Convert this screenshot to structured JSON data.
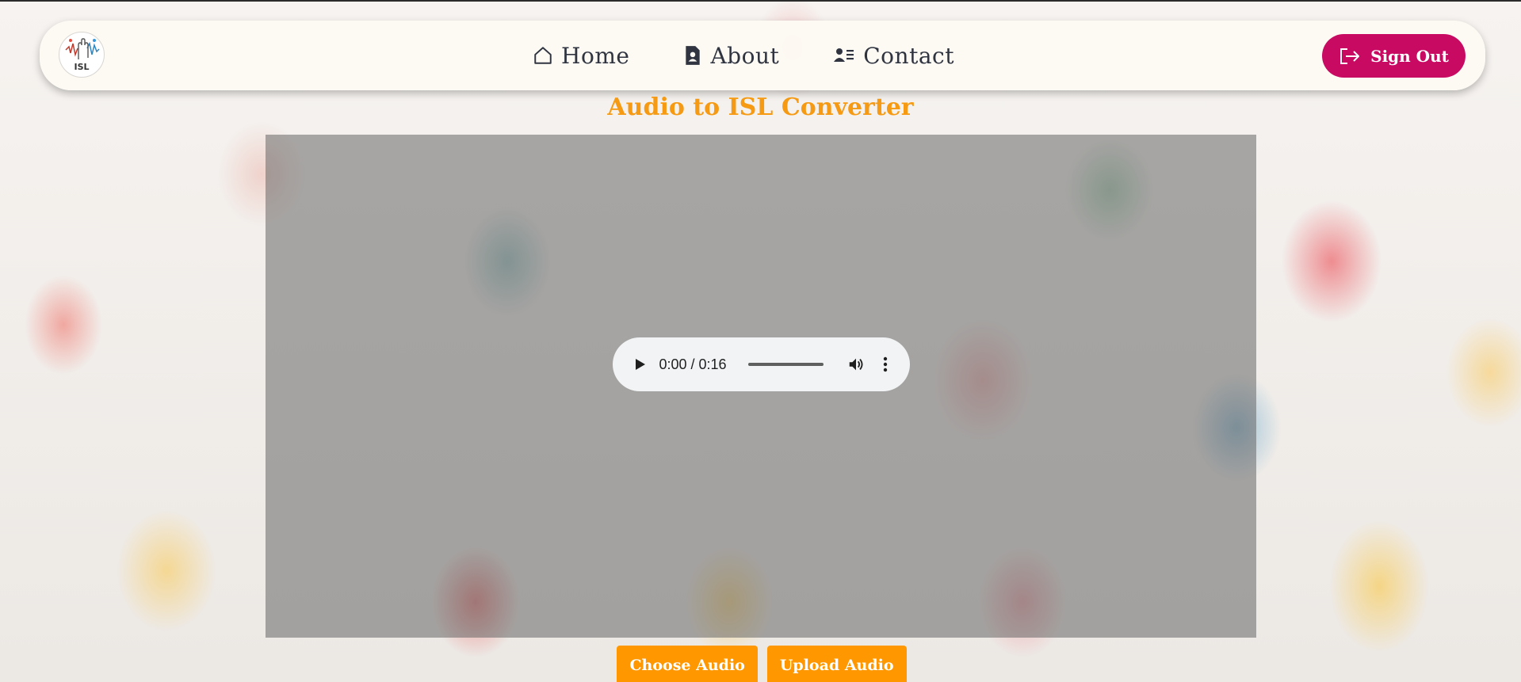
{
  "logo": {
    "text": "ISL"
  },
  "nav": {
    "items": [
      {
        "label": "Home",
        "icon": "home-icon"
      },
      {
        "label": "About",
        "icon": "document-user-icon"
      },
      {
        "label": "Contact",
        "icon": "contact-card-icon"
      }
    ],
    "sign_out_label": "Sign Out",
    "sign_out_icon": "sign-out-icon"
  },
  "page": {
    "title": "Audio to ISL Converter"
  },
  "audio_player": {
    "time": "0:00 / 0:16",
    "progress": 0,
    "icons": [
      "play-icon",
      "volume-icon",
      "more-vert-icon"
    ]
  },
  "actions": {
    "choose_label": "Choose Audio",
    "upload_label": "Upload Audio"
  },
  "colors": {
    "accent_orange": "#ff9800",
    "title_orange": "#f59a12",
    "sign_out": "#c80a63",
    "nav_text": "#2f3440"
  }
}
